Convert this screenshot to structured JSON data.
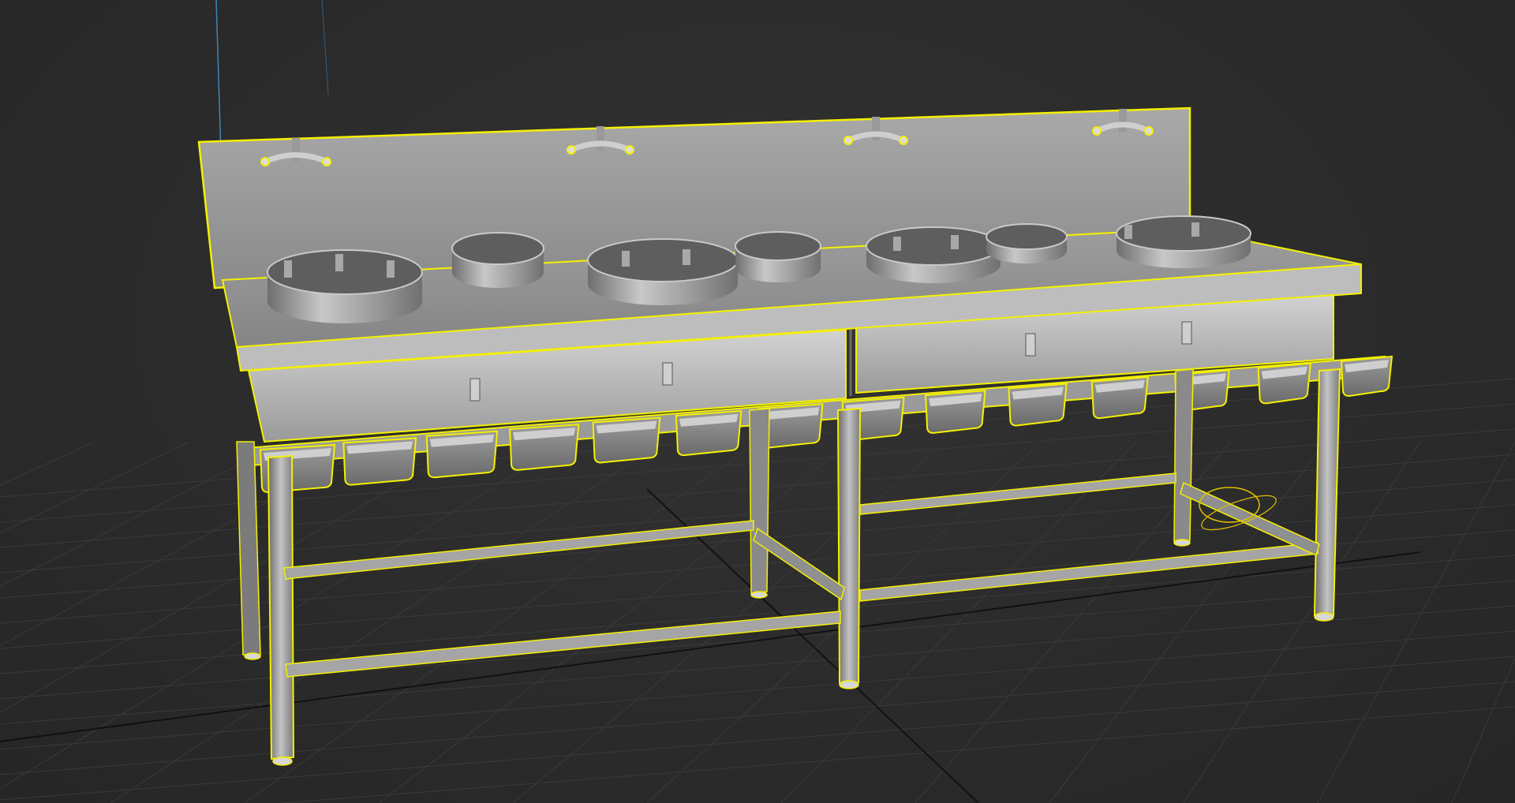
{
  "viewport": {
    "background_color": "#2b2b2b",
    "grid_color": "#3a3a3a",
    "grid_axis_color": "#111111",
    "vertical_axis_color": "#3f86b8"
  },
  "selected_object": {
    "kind": "commercial wok range with backsplash, faucets, burners, ingredient trays and steel frame",
    "selection_outline_color": "#f4f000",
    "metal_light": "#b5b5b5",
    "metal_mid": "#8f8f8f",
    "metal_dark": "#5e5e5e"
  },
  "gizmo": {
    "kind": "rotate-handle",
    "color": "#e0c100"
  }
}
